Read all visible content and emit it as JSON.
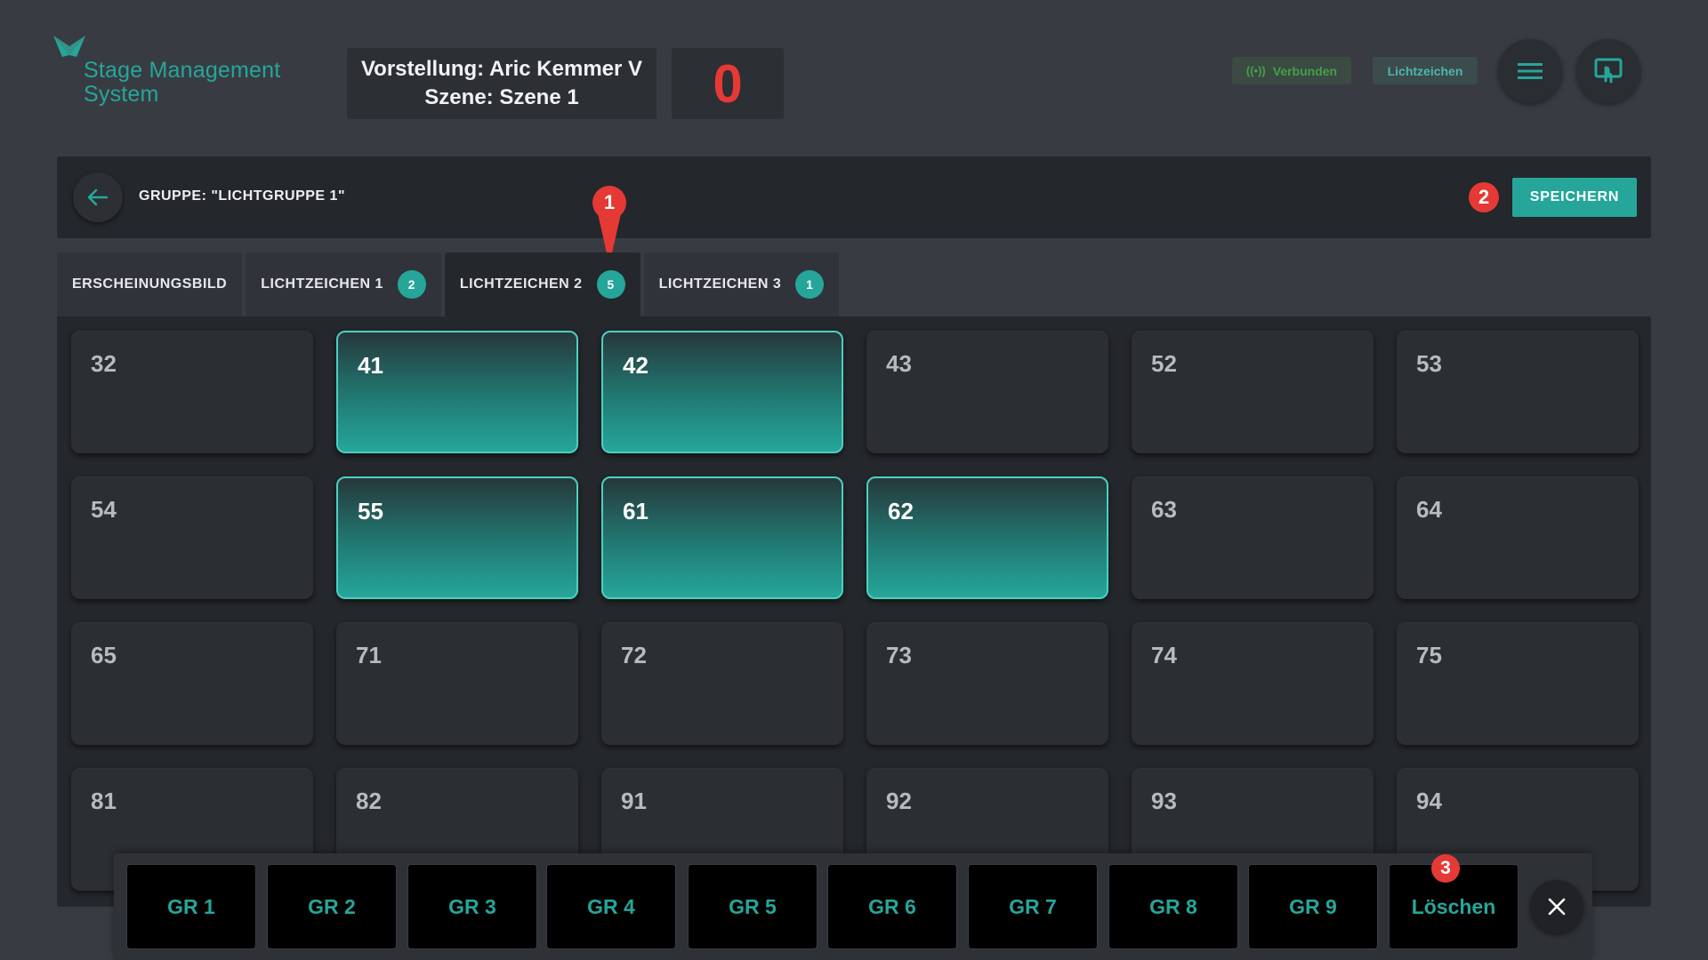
{
  "header": {
    "logo_line1": "Stage Management",
    "logo_line2": "System",
    "performance_label": "Vorstellung: Aric Kemmer V",
    "scene_label": "Szene: Szene 1",
    "counter": "0",
    "status_connected": "Verbunden",
    "status_mode": "Lichtzeichen",
    "menu_icon": "hamburger-menu-icon",
    "screen_icon": "touch-screen-icon"
  },
  "group_bar": {
    "title": "GRUPPE: \"LICHTGRUPPE 1\"",
    "save_label": "SPEICHERN",
    "back_icon": "arrow-left-icon"
  },
  "markers": [
    "1",
    "2",
    "3"
  ],
  "tabs": [
    {
      "label": "ERSCHEINUNGSBILD",
      "badge": null,
      "active": false
    },
    {
      "label": "LICHTZEICHEN 1",
      "badge": "2",
      "active": false
    },
    {
      "label": "LICHTZEICHEN 2",
      "badge": "5",
      "active": true
    },
    {
      "label": "LICHTZEICHEN 3",
      "badge": "1",
      "active": false
    }
  ],
  "cues": [
    {
      "label": "32",
      "selected": false
    },
    {
      "label": "41",
      "selected": true
    },
    {
      "label": "42",
      "selected": true
    },
    {
      "label": "43",
      "selected": false
    },
    {
      "label": "52",
      "selected": false
    },
    {
      "label": "53",
      "selected": false
    },
    {
      "label": "54",
      "selected": false
    },
    {
      "label": "55",
      "selected": true
    },
    {
      "label": "61",
      "selected": true
    },
    {
      "label": "62",
      "selected": true
    },
    {
      "label": "63",
      "selected": false
    },
    {
      "label": "64",
      "selected": false
    },
    {
      "label": "65",
      "selected": false
    },
    {
      "label": "71",
      "selected": false
    },
    {
      "label": "72",
      "selected": false
    },
    {
      "label": "73",
      "selected": false
    },
    {
      "label": "74",
      "selected": false
    },
    {
      "label": "75",
      "selected": false
    },
    {
      "label": "81",
      "selected": false
    },
    {
      "label": "82",
      "selected": false
    },
    {
      "label": "91",
      "selected": false
    },
    {
      "label": "92",
      "selected": false
    },
    {
      "label": "93",
      "selected": false
    },
    {
      "label": "94",
      "selected": false
    }
  ],
  "toolbar": {
    "buttons": [
      "GR 1",
      "GR 2",
      "GR 3",
      "GR 4",
      "GR 5",
      "GR 6",
      "GR 7",
      "GR 8",
      "GR 9",
      "Löschen"
    ],
    "close_icon": "close-icon"
  },
  "colors": {
    "accent": "#26a69a",
    "marker": "#e53935",
    "background": "#383c42",
    "panel": "#24272b"
  }
}
